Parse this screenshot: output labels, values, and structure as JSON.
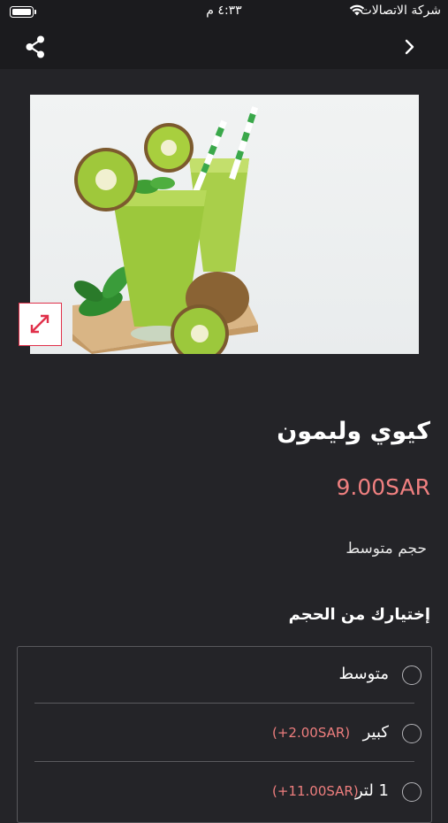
{
  "status_bar": {
    "carrier": "شركة الاتصالات",
    "time": "٤:٣٣ م"
  },
  "nav": {
    "share_icon": "share-icon",
    "back_icon": "chevron-right-icon"
  },
  "product": {
    "image_description_icon": "expand-icon",
    "title": "كيوي وليمون",
    "price": "9.00SAR",
    "description": "حجم متوسط"
  },
  "size_section": {
    "title": "إختيارك من الحجم",
    "options": [
      {
        "label": "متوسط",
        "extra": ""
      },
      {
        "label": "كبير",
        "extra": "(+2.00SAR)"
      },
      {
        "label": "1 لتر",
        "extra": "(+11.00SAR)"
      }
    ]
  },
  "colors": {
    "background": "#242428",
    "bar": "#1b1b1e",
    "price": "#f08080",
    "accent": "#e0304a"
  }
}
